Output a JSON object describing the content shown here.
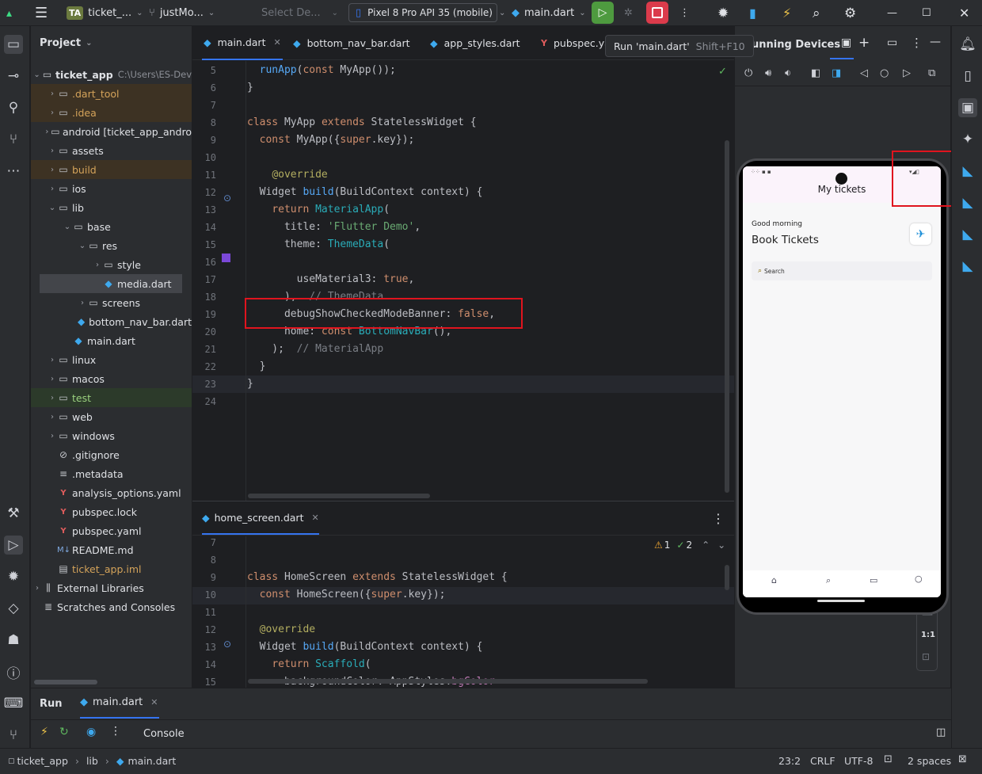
{
  "topbar": {
    "project_badge": "TA",
    "project_name": "ticket_...",
    "vcs_branch": "justMo...",
    "device_placeholder": "Select De...",
    "device_name": "Pixel 8 Pro API 35 (mobile)",
    "run_config": "main.dart"
  },
  "tooltip": {
    "text": "Run 'main.dart'",
    "shortcut": "Shift+F10"
  },
  "project_panel": {
    "title": "Project",
    "root_name": "ticket_app",
    "root_path": "C:\\Users\\ES-Dev",
    "items": [
      {
        "label": ".dart_tool",
        "depth": 1,
        "type": "folder",
        "state": "excluded",
        "arrow": "›"
      },
      {
        "label": ".idea",
        "depth": 1,
        "type": "folder",
        "state": "excluded",
        "arrow": "›"
      },
      {
        "label": "android [ticket_app_andro",
        "depth": 1,
        "type": "folder",
        "state": "",
        "arrow": "›"
      },
      {
        "label": "assets",
        "depth": 1,
        "type": "folder",
        "state": "",
        "arrow": "›"
      },
      {
        "label": "build",
        "depth": 1,
        "type": "folder",
        "state": "excluded",
        "arrow": "›"
      },
      {
        "label": "ios",
        "depth": 1,
        "type": "folder",
        "state": "",
        "arrow": "›"
      },
      {
        "label": "lib",
        "depth": 1,
        "type": "folder",
        "state": "",
        "arrow": "⌄"
      },
      {
        "label": "base",
        "depth": 2,
        "type": "folder",
        "state": "",
        "arrow": "⌄"
      },
      {
        "label": "res",
        "depth": 3,
        "type": "folder",
        "state": "",
        "arrow": "⌄"
      },
      {
        "label": "style",
        "depth": 4,
        "type": "folder",
        "state": "",
        "arrow": "›"
      },
      {
        "label": "media.dart",
        "depth": 4,
        "type": "dart",
        "state": "selected",
        "arrow": ""
      },
      {
        "label": "screens",
        "depth": 3,
        "type": "folder",
        "state": "",
        "arrow": "›"
      },
      {
        "label": "bottom_nav_bar.dart",
        "depth": 3,
        "type": "dart",
        "state": "",
        "arrow": ""
      },
      {
        "label": "main.dart",
        "depth": 2,
        "type": "dart",
        "state": "",
        "arrow": ""
      },
      {
        "label": "linux",
        "depth": 1,
        "type": "folder",
        "state": "",
        "arrow": "›"
      },
      {
        "label": "macos",
        "depth": 1,
        "type": "folder",
        "state": "",
        "arrow": "›"
      },
      {
        "label": "test",
        "depth": 1,
        "type": "folder",
        "state": "test",
        "arrow": "›"
      },
      {
        "label": "web",
        "depth": 1,
        "type": "folder",
        "state": "",
        "arrow": "›"
      },
      {
        "label": "windows",
        "depth": 1,
        "type": "folder",
        "state": "",
        "arrow": "›"
      },
      {
        "label": ".gitignore",
        "depth": 1,
        "type": "ignore",
        "state": "",
        "arrow": ""
      },
      {
        "label": ".metadata",
        "depth": 1,
        "type": "text",
        "state": "",
        "arrow": ""
      },
      {
        "label": "analysis_options.yaml",
        "depth": 1,
        "type": "yaml",
        "state": "",
        "arrow": ""
      },
      {
        "label": "pubspec.lock",
        "depth": 1,
        "type": "yaml",
        "state": "",
        "arrow": ""
      },
      {
        "label": "pubspec.yaml",
        "depth": 1,
        "type": "yaml",
        "state": "",
        "arrow": ""
      },
      {
        "label": "README.md",
        "depth": 1,
        "type": "md",
        "state": "",
        "arrow": ""
      },
      {
        "label": "ticket_app.iml",
        "depth": 1,
        "type": "iml",
        "state": "iml",
        "arrow": ""
      },
      {
        "label": "External Libraries",
        "depth": 0,
        "type": "lib",
        "state": "",
        "arrow": "›"
      },
      {
        "label": "Scratches and Consoles",
        "depth": 0,
        "type": "scratch",
        "state": "",
        "arrow": ""
      }
    ]
  },
  "editor_top": {
    "tabs": [
      {
        "label": "main.dart",
        "active": true,
        "icon": "dart"
      },
      {
        "label": "bottom_nav_bar.dart",
        "active": false,
        "icon": "dart"
      },
      {
        "label": "app_styles.dart",
        "active": false,
        "icon": "dart"
      },
      {
        "label": "pubspec.ya",
        "active": false,
        "icon": "yaml"
      }
    ],
    "line_numbers": [
      "5",
      "6",
      "7",
      "8",
      "9",
      "10",
      "11",
      "12",
      "13",
      "14",
      "15",
      "16",
      "17",
      "18",
      "19",
      "20",
      "21",
      "22",
      "23",
      "24"
    ],
    "lines": [
      [
        "  runApp(const MyApp());"
      ],
      [
        "}"
      ],
      [
        ""
      ],
      [
        "class MyApp extends StatelessWidget {"
      ],
      [
        "  const MyApp({super.key});"
      ],
      [
        ""
      ],
      [
        "    @override"
      ],
      [
        "  Widget build(BuildContext context) {"
      ],
      [
        "    return MaterialApp("
      ],
      [
        "      title: 'Flutter Demo',"
      ],
      [
        "      theme: ThemeData("
      ],
      [
        ""
      ],
      [
        "        useMaterial3: true,"
      ],
      [
        "      ),  // ThemeData"
      ],
      [
        "      debugShowCheckedModeBanner: false,"
      ],
      [
        "      home: const BottomNavBar(),"
      ],
      [
        "    );  // MaterialApp"
      ],
      [
        "  }"
      ],
      [
        "}"
      ],
      [
        ""
      ]
    ]
  },
  "editor_bottom": {
    "tab": "home_screen.dart",
    "warnings": "1",
    "weak_warnings": "2",
    "line_numbers": [
      "7",
      "8",
      "9",
      "10",
      "11",
      "12",
      "13",
      "14",
      "15"
    ],
    "lines": [
      [
        ""
      ],
      [
        ""
      ],
      [
        "class HomeScreen extends StatelessWidget {"
      ],
      [
        "  const HomeScreen({super.key});"
      ],
      [
        ""
      ],
      [
        "  @override"
      ],
      [
        "  Widget build(BuildContext context) {"
      ],
      [
        "    return Scaffold("
      ],
      [
        "      backgroundColor: AppStyles.bgColor"
      ]
    ]
  },
  "devices_panel": {
    "title": "Running Devices",
    "zoom_reset": "1:1"
  },
  "phone_app": {
    "app_title": "My tickets",
    "greeting": "Good morning",
    "heading": "Book Tickets",
    "search_placeholder": "Search"
  },
  "run_panel": {
    "title": "Run",
    "tab": "main.dart",
    "console_label": "Console"
  },
  "statusbar": {
    "crumb_project": "ticket_app",
    "crumb_dir": "lib",
    "crumb_file": "main.dart",
    "position": "23:2",
    "line_sep": "CRLF",
    "encoding": "UTF-8",
    "indent": "2 spaces"
  },
  "colors": {
    "highlight_box": "#e0141e",
    "accent": "#3574f0",
    "run_green": "#4e9a3f",
    "stop_red": "#db3b4b"
  }
}
